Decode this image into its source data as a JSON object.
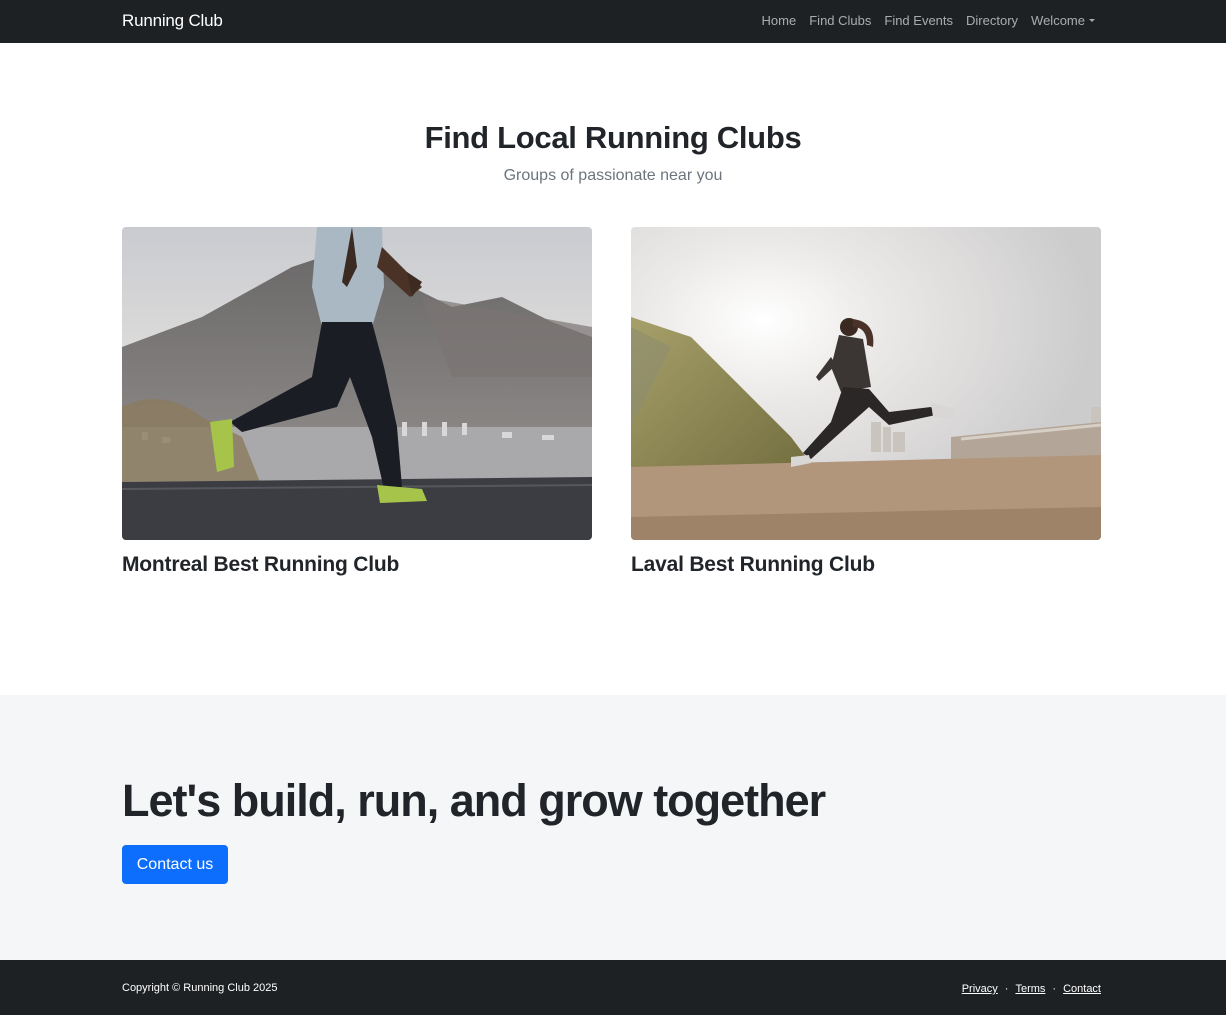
{
  "navbar": {
    "brand": "Running Club",
    "links": [
      "Home",
      "Find Clubs",
      "Find Events",
      "Directory"
    ],
    "dropdown_label": "Welcome"
  },
  "hero": {
    "title": "Find Local Running Clubs",
    "subtitle": "Groups of passionate near you"
  },
  "clubs": [
    {
      "title": "Montreal Best Running Club"
    },
    {
      "title": "Laval Best Running Club"
    }
  ],
  "cta": {
    "title": "Let's build, run, and grow together",
    "button_label": "Contact us",
    "accent_color": "#0d6efd"
  },
  "footer": {
    "copyright": "Copyright © Running Club 2025",
    "links": [
      "Privacy",
      "Terms",
      "Contact"
    ],
    "separator": "·"
  }
}
